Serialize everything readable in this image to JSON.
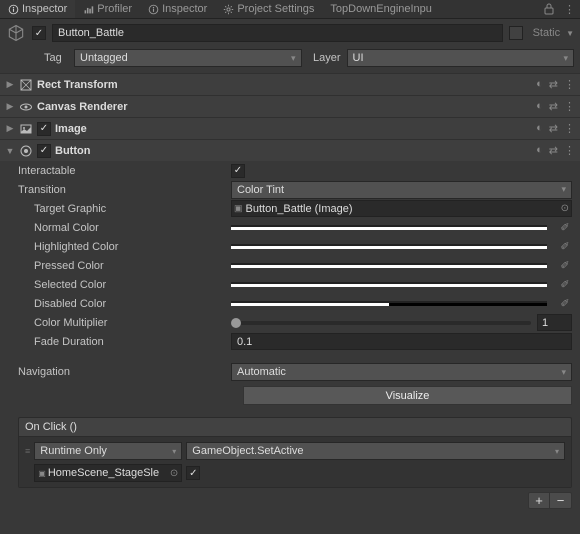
{
  "tabs": [
    {
      "label": "Inspector",
      "icon": "info"
    },
    {
      "label": "Profiler",
      "icon": "profiler"
    },
    {
      "label": "Inspector",
      "icon": "info"
    },
    {
      "label": "Project Settings",
      "icon": "settings"
    },
    {
      "label": "TopDownEngineInpu",
      "icon": "asset"
    }
  ],
  "object": {
    "name": "Button_Battle",
    "active": true,
    "static_label": "Static",
    "tag_label": "Tag",
    "tag_value": "Untagged",
    "layer_label": "Layer",
    "layer_value": "UI"
  },
  "components": [
    {
      "name": "Rect Transform",
      "expanded": false,
      "enabled": null,
      "icon": "rect"
    },
    {
      "name": "Canvas Renderer",
      "expanded": false,
      "enabled": null,
      "icon": "eye"
    },
    {
      "name": "Image",
      "expanded": false,
      "enabled": true,
      "icon": "image"
    },
    {
      "name": "Button",
      "expanded": true,
      "enabled": true,
      "icon": "button"
    }
  ],
  "button_component": {
    "interactable_label": "Interactable",
    "interactable": true,
    "transition_label": "Transition",
    "transition_value": "Color Tint",
    "target_graphic_label": "Target Graphic",
    "target_graphic_value": "Button_Battle (Image)",
    "colors": {
      "normal_label": "Normal Color",
      "normal": "#FFFFFF",
      "highlighted_label": "Highlighted Color",
      "highlighted": "#F5F5F5",
      "pressed_label": "Pressed Color",
      "pressed": "#C8C8C8",
      "selected_label": "Selected Color",
      "selected": "#F5F5F5",
      "disabled_label": "Disabled Color",
      "disabled": "#C8C8C8",
      "disabled_alpha": 0.5
    },
    "color_multiplier_label": "Color Multiplier",
    "color_multiplier": "1",
    "fade_duration_label": "Fade Duration",
    "fade_duration": "0.1",
    "navigation_label": "Navigation",
    "navigation_value": "Automatic",
    "visualize_label": "Visualize",
    "event_header": "On Click ()",
    "event_runtime": "Runtime Only",
    "event_function": "GameObject.SetActive",
    "event_target": "HomeScene_StageSle",
    "event_bool": true
  }
}
